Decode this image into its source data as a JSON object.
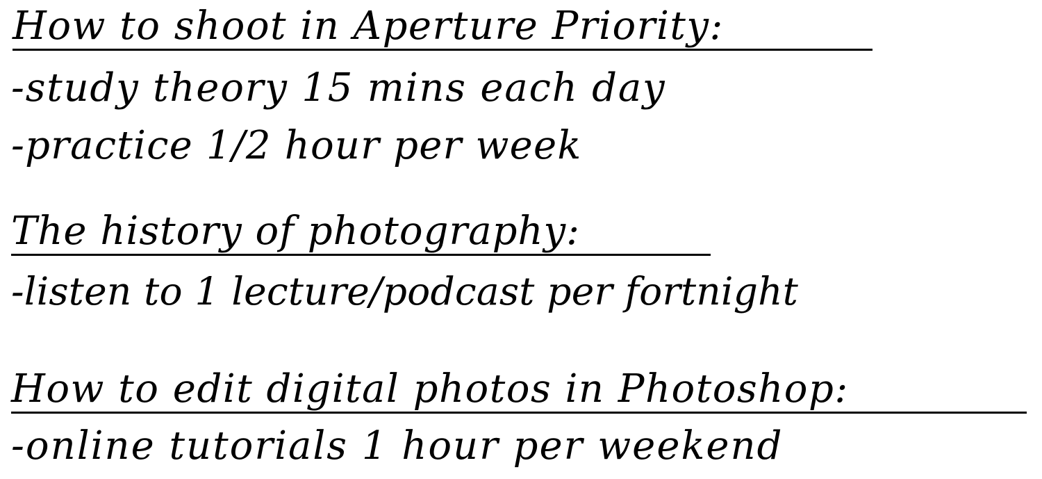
{
  "sections": [
    {
      "heading": "How to shoot in Aperture Priority:",
      "items": [
        "-study theory 15 mins each day",
        "-practice 1/2 hour per week"
      ]
    },
    {
      "heading": "The history of photography:",
      "items": [
        "-listen to 1 lecture/podcast per fortnight"
      ]
    },
    {
      "heading": "How to edit digital photos in Photoshop:",
      "items": [
        "-online tutorials 1 hour per weekend"
      ]
    }
  ]
}
